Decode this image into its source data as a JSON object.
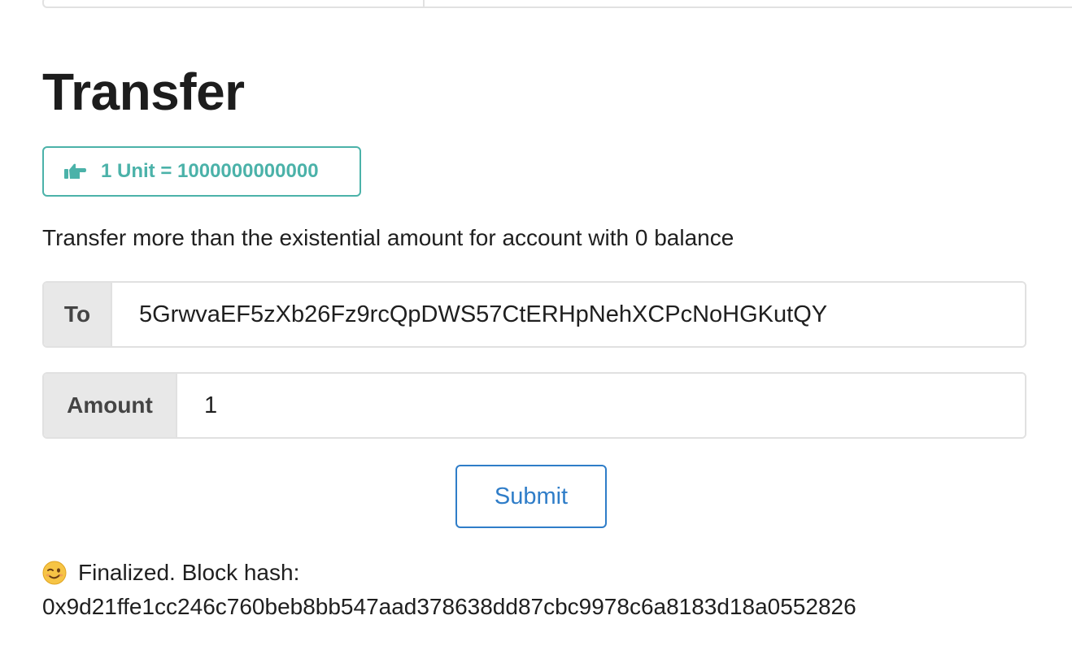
{
  "page": {
    "title": "Transfer"
  },
  "unit_label": {
    "text": "1 Unit = 1000000000000",
    "icon": "hand-pointing-right-icon",
    "color": "#4bb2a9"
  },
  "hint": "Transfer more than the existential amount for account with 0 balance",
  "form": {
    "to": {
      "label": "To",
      "value": "5GrwvaEF5zXb26Fz9rcQpDWS57CtERHpNehXCPcNoHGKutQY",
      "placeholder": ""
    },
    "amount": {
      "label": "Amount",
      "value": "1",
      "placeholder": ""
    },
    "submit_label": "Submit"
  },
  "status": {
    "emoji": "winking-face-icon",
    "message": "Finalized. Block hash:",
    "hash": "0x9d21ffe1cc246c760beb8bb547aad378638dd87cbc9978c6a8183d18a0552826"
  },
  "colors": {
    "accent_teal": "#4bb2a9",
    "primary_blue": "#2f7dc8"
  }
}
